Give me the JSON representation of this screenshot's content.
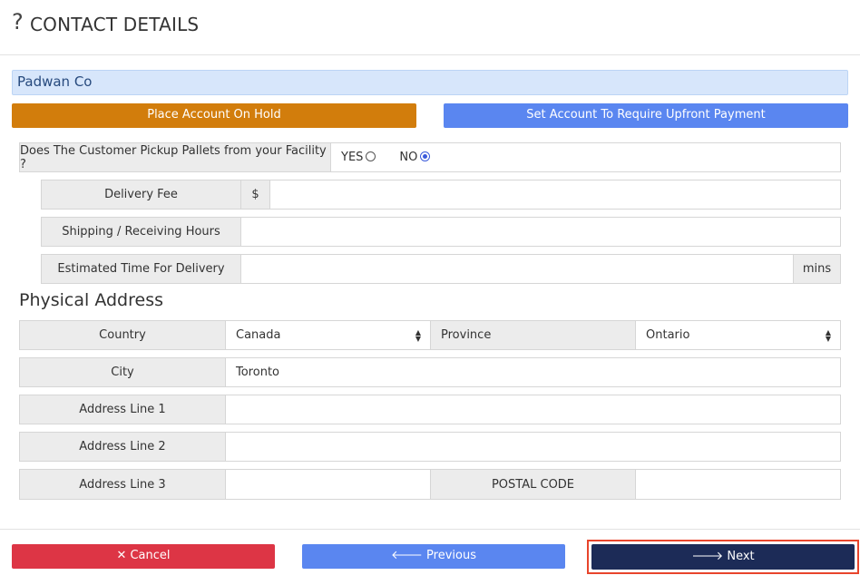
{
  "header": {
    "icon": "question-icon",
    "icon_glyph": "?",
    "title": "CONTACT DETAILS"
  },
  "company": {
    "name": "Padwan Co"
  },
  "actions": {
    "hold_label": "Place Account On Hold",
    "upfront_label": "Set Account To Require Upfront Payment",
    "hold_color": "#d27d0c",
    "upfront_color": "#5a86f0"
  },
  "pickup": {
    "question": "Does The Customer Pickup Pallets from your Facility ?",
    "yes_label": "YES",
    "no_label": "NO",
    "selected": "NO"
  },
  "delivery_fee": {
    "label": "Delivery Fee",
    "prefix": "$",
    "value": ""
  },
  "shipping_hours": {
    "label": "Shipping / Receiving Hours",
    "value": ""
  },
  "est_delivery": {
    "label": "Estimated Time For Delivery",
    "value": "",
    "suffix": "mins"
  },
  "physical_address": {
    "title": "Physical Address",
    "country_label": "Country",
    "country_value": "Canada",
    "province_label": "Province",
    "province_value": "Ontario",
    "city_label": "City",
    "city_value": "Toronto",
    "address1_label": "Address Line 1",
    "address1_value": "",
    "address2_label": "Address Line 2",
    "address2_value": "",
    "address3_label": "Address Line 3",
    "address3_value": "",
    "postal_label": "POSTAL CODE",
    "postal_value": ""
  },
  "footer": {
    "cancel_label": "✕ Cancel",
    "previous_label": "🡐 Previous",
    "next_label": "🡒 Next",
    "cancel_color": "#dd3545",
    "previous_color": "#5a86f0",
    "next_color": "#1c2b57"
  }
}
